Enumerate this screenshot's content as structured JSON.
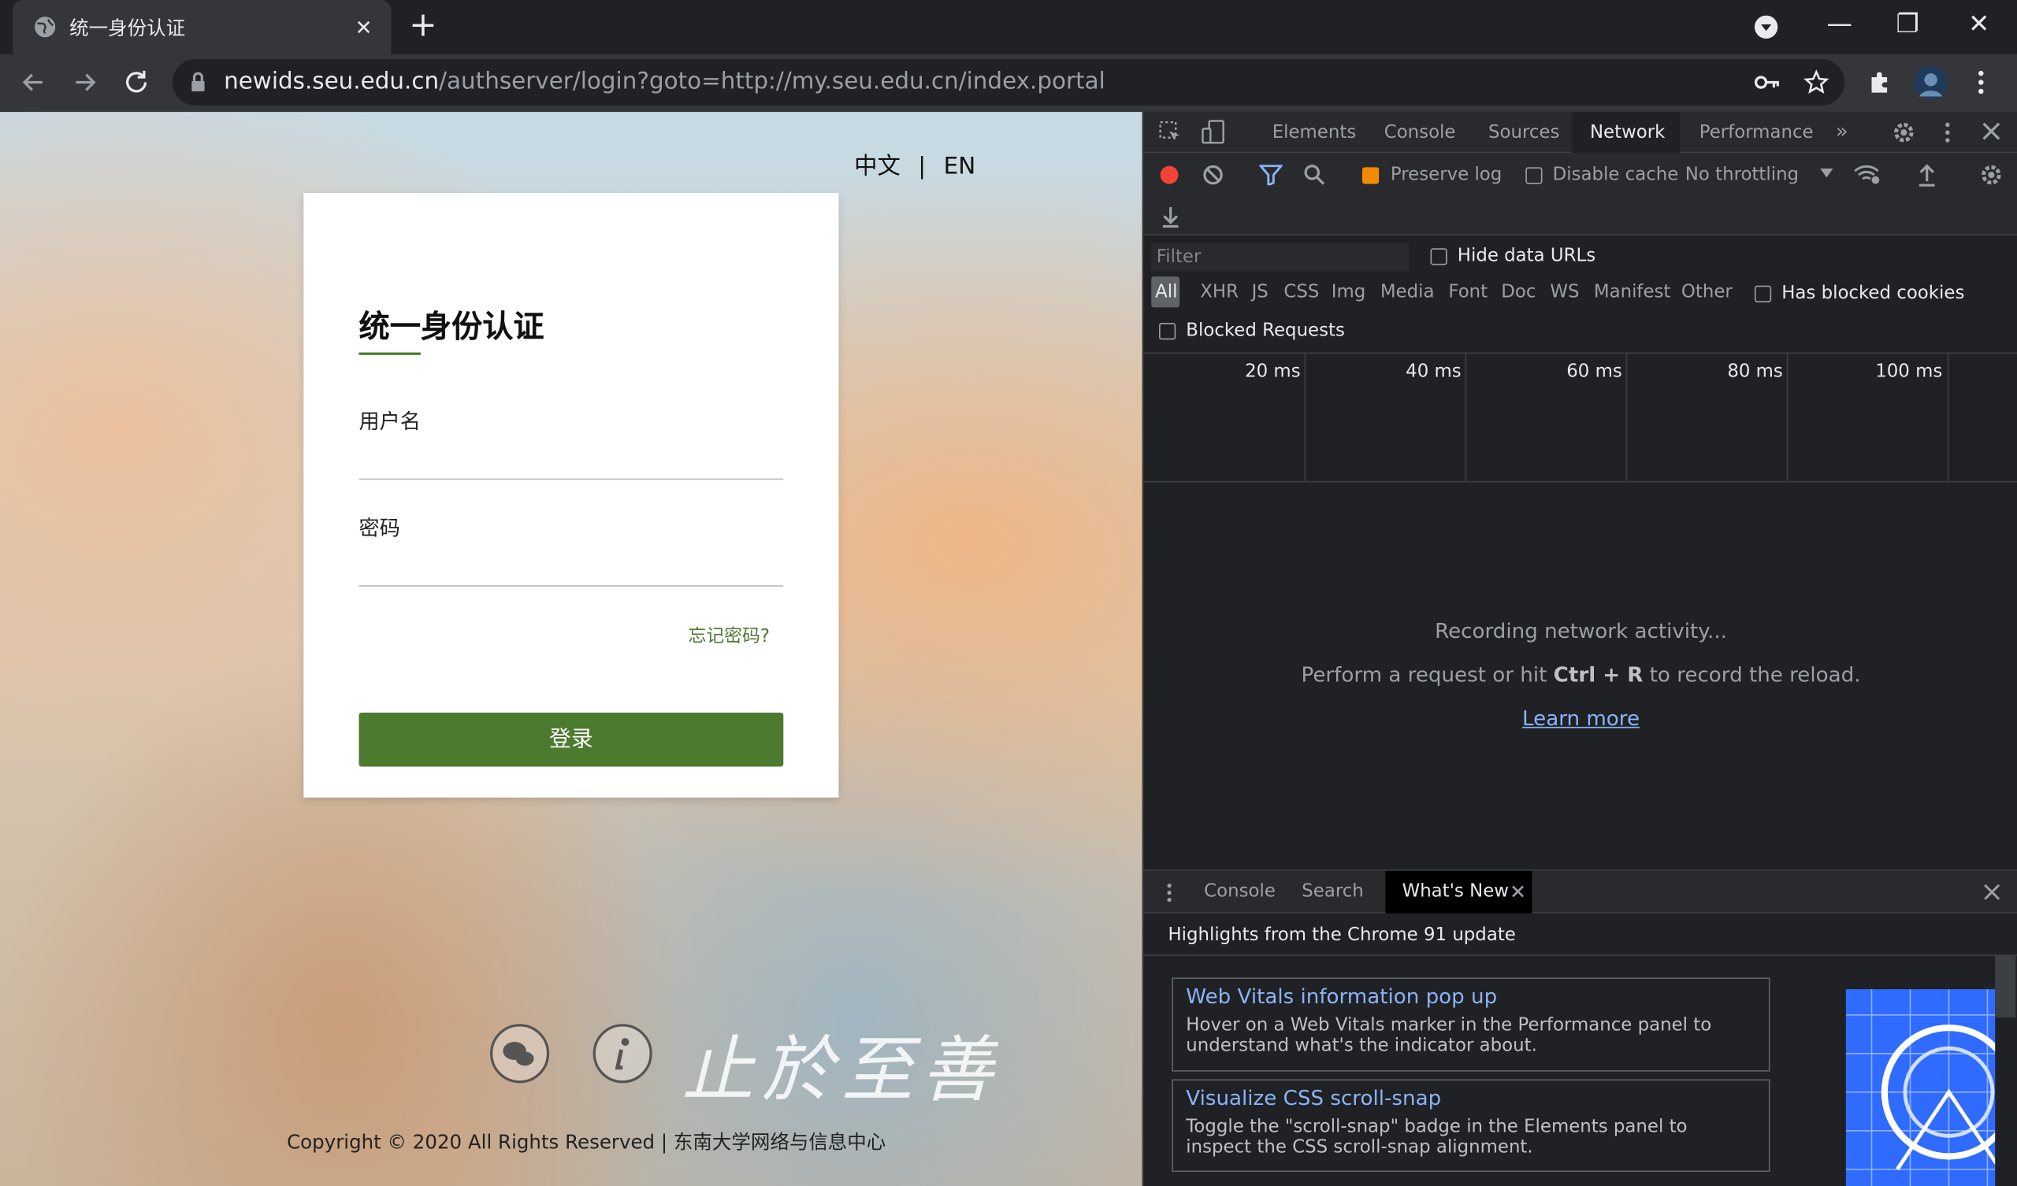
{
  "browser": {
    "tab_title": "统一身份认证",
    "close": "✕",
    "newtab": "+",
    "url_host": "newids.seu.edu.cn",
    "url_path": "/authserver/login?goto=http://my.seu.edu.cn/index.portal",
    "window_controls": [
      "—",
      "❐",
      "✕"
    ]
  },
  "page": {
    "lang_zh": "中文",
    "lang_sep": "|",
    "lang_en": "EN",
    "title": "统一身份认证",
    "username_label": "用户名",
    "password_label": "密码",
    "forgot": "忘记密码?",
    "login": "登录",
    "motto": "止於至善",
    "copyright": "Copyright © 2020 All Rights Reserved | 东南大学网络与信息中心"
  },
  "devtools": {
    "tabs": [
      "Elements",
      "Console",
      "Sources",
      "Network",
      "Performance"
    ],
    "more": "»",
    "preserve_log": "Preserve log",
    "disable_cache": "Disable cache",
    "throttling": "No throttling",
    "filter_placeholder": "Filter",
    "hide_data_urls": "Hide data URLs",
    "types": [
      "All",
      "XHR",
      "JS",
      "CSS",
      "Img",
      "Media",
      "Font",
      "Doc",
      "WS",
      "Manifest",
      "Other"
    ],
    "has_blocked_cookies": "Has blocked cookies",
    "blocked_requests": "Blocked Requests",
    "ticks": [
      "20 ms",
      "40 ms",
      "60 ms",
      "80 ms",
      "100 ms"
    ],
    "recording": "Recording network activity...",
    "perform_pre": "Perform a request or hit ",
    "perform_key": "Ctrl + R",
    "perform_post": " to record the reload.",
    "learn_more": "Learn more",
    "drawer_tabs": [
      "Console",
      "Search",
      "What's New"
    ],
    "highlights": "Highlights from the Chrome 91 update",
    "cards": [
      {
        "title": "Web Vitals information pop up",
        "desc": "Hover on a Web Vitals marker in the Performance panel to understand what's the indicator about."
      },
      {
        "title": "Visualize CSS scroll-snap",
        "desc": "Toggle the \"scroll-snap\" badge in the Elements panel to inspect the CSS scroll-snap alignment."
      }
    ]
  },
  "colors": {
    "accent_green": "#4c7a2f",
    "link_blue": "#8ab4f8",
    "record_red": "#f44336"
  }
}
